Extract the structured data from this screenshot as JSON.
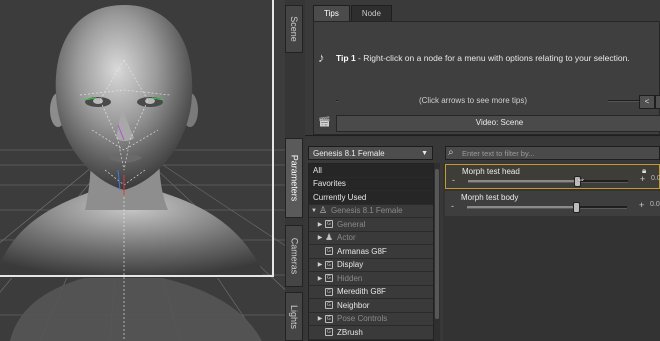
{
  "colors": {
    "selection_border": "#c79a2f",
    "panel_bg": "#363636",
    "viewport_bg": "#3c3c3c"
  },
  "side_tabs": {
    "scene": "Scene",
    "parameters": "Parameters",
    "cameras": "Cameras",
    "lights": "Lights"
  },
  "tips_pane": {
    "tabs": [
      "Tips",
      "Node"
    ],
    "tip_title": "Tip 1",
    "tip_text": " - Right-click on a node for a menu with options relating to your selection.",
    "nav_hint": "(Click arrows to see more tips)",
    "prev_label": "<",
    "next_label": ">",
    "video_label": "Video: Scene",
    "tip_icon": "music-note-icon",
    "video_icon": "clapperboard-icon"
  },
  "parameters_pane": {
    "figure_selector": "Genesis 8.1 Female",
    "filter_placeholder": "Enter text to filter by...",
    "filter_icon": "search-icon",
    "categories": [
      "All",
      "Favorites",
      "Currently Used"
    ],
    "tree": [
      {
        "label": "Genesis 8.1 Female",
        "toggle": "▼",
        "icon": "figure",
        "dim": true,
        "indent": 0
      },
      {
        "label": "General",
        "toggle": "▶",
        "icon": "box",
        "dim": true,
        "indent": 1
      },
      {
        "label": "Actor",
        "toggle": "▶",
        "icon": "person",
        "dim": true,
        "indent": 1
      },
      {
        "label": "Armanas G8F",
        "toggle": "",
        "icon": "box",
        "dim": false,
        "indent": 1
      },
      {
        "label": "Display",
        "toggle": "▶",
        "icon": "box",
        "dim": false,
        "indent": 1
      },
      {
        "label": "Hidden",
        "toggle": "▶",
        "icon": "box",
        "dim": true,
        "indent": 1
      },
      {
        "label": "Meredith G8F",
        "toggle": "",
        "icon": "box",
        "dim": false,
        "indent": 1
      },
      {
        "label": "Neighbor",
        "toggle": "",
        "icon": "box",
        "dim": false,
        "indent": 1
      },
      {
        "label": "Pose Controls",
        "toggle": "▶",
        "icon": "box",
        "dim": true,
        "indent": 1
      },
      {
        "label": "ZBrush",
        "toggle": "",
        "icon": "box",
        "dim": false,
        "indent": 1
      }
    ],
    "sliders": [
      {
        "label": "Morph test head",
        "value_fraction": 0.68,
        "selected": true,
        "minus": "-",
        "plus": "+",
        "value_text": "0.0"
      },
      {
        "label": "Morph test body",
        "value_fraction": 0.68,
        "selected": false,
        "minus": "-",
        "plus": "+",
        "value_text": "0.0"
      }
    ]
  }
}
